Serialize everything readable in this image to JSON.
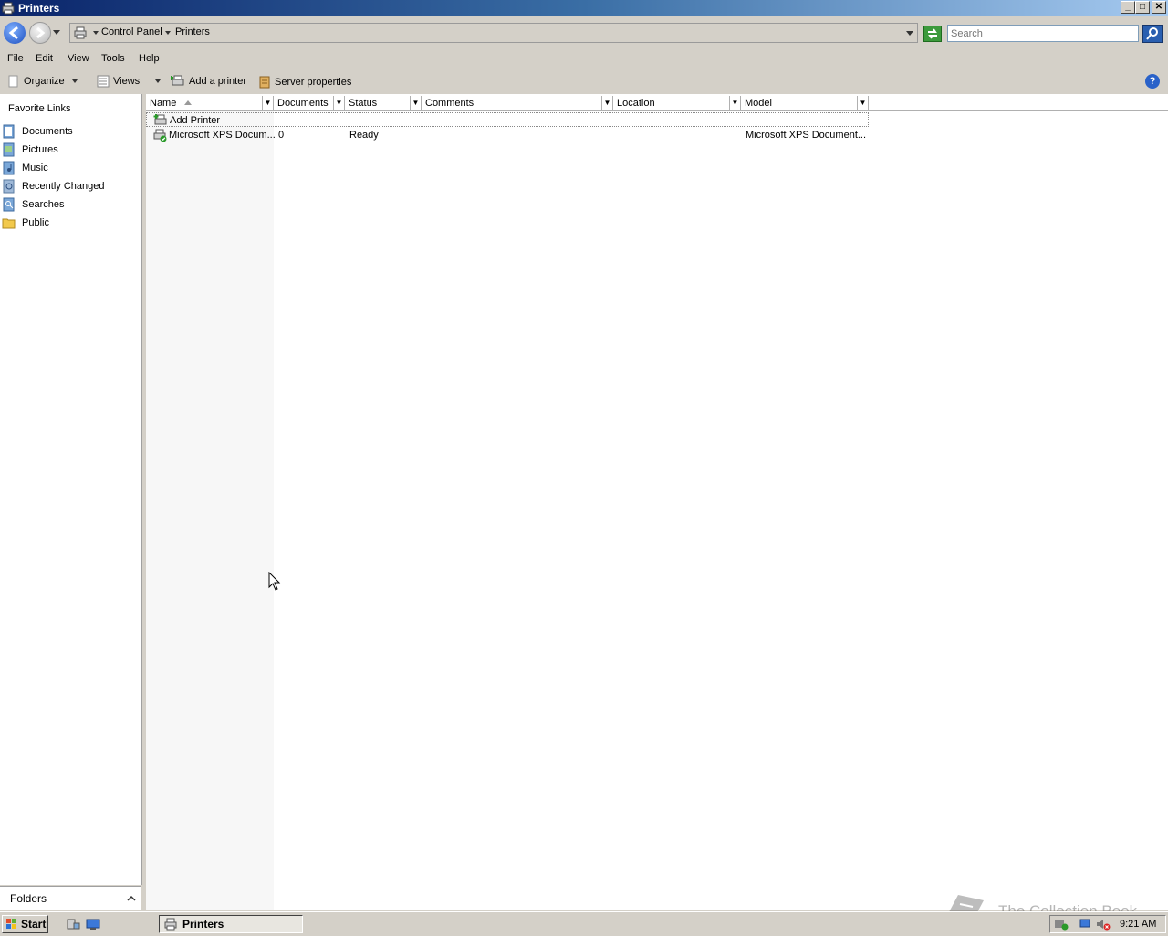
{
  "window": {
    "title": "Printers"
  },
  "address": {
    "crumbs": [
      "Control Panel",
      "Printers"
    ]
  },
  "search": {
    "placeholder": "Search"
  },
  "menu": {
    "items": [
      "File",
      "Edit",
      "View",
      "Tools",
      "Help"
    ]
  },
  "toolbar": {
    "organize": "Organize",
    "views": "Views",
    "add_printer": "Add a printer",
    "server_properties": "Server properties"
  },
  "nav": {
    "header": "Favorite Links",
    "items": [
      "Documents",
      "Pictures",
      "Music",
      "Recently Changed",
      "Searches",
      "Public"
    ],
    "folders": "Folders"
  },
  "columns": [
    "Name",
    "Documents",
    "Status",
    "Comments",
    "Location",
    "Model"
  ],
  "rows": [
    {
      "name": "Add Printer",
      "documents": "",
      "status": "",
      "comments": "",
      "location": "",
      "model": ""
    },
    {
      "name": "Microsoft XPS Docum...",
      "documents": "0",
      "status": "Ready",
      "comments": "",
      "location": "",
      "model": "Microsoft XPS Document..."
    }
  ],
  "taskbar": {
    "start": "Start",
    "task": "Printers",
    "clock": "9:21 AM"
  },
  "watermark": {
    "text": "The Collection Book"
  }
}
